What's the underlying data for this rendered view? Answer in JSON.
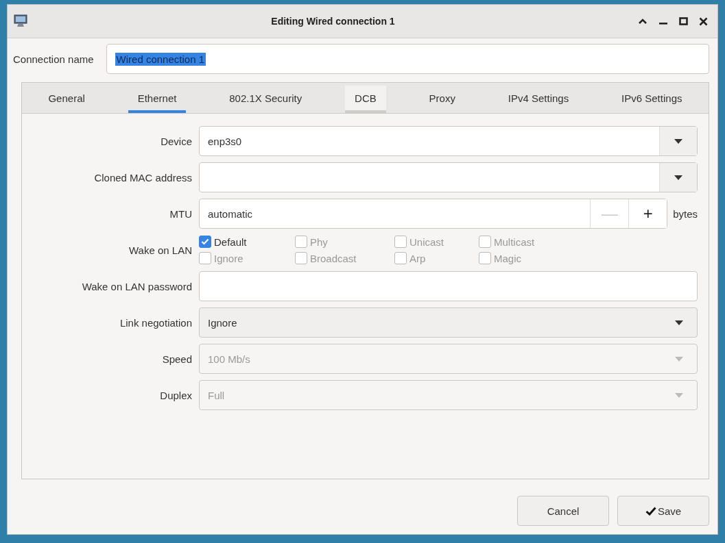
{
  "window": {
    "title": "Editing Wired connection 1"
  },
  "connection_name": {
    "label": "Connection name",
    "value": "Wired connection 1"
  },
  "tabs": [
    {
      "label": "General",
      "selected": false,
      "hovered": false
    },
    {
      "label": "Ethernet",
      "selected": true,
      "hovered": false
    },
    {
      "label": "802.1X Security",
      "selected": false,
      "hovered": false
    },
    {
      "label": "DCB",
      "selected": false,
      "hovered": true
    },
    {
      "label": "Proxy",
      "selected": false,
      "hovered": false
    },
    {
      "label": "IPv4 Settings",
      "selected": false,
      "hovered": false
    },
    {
      "label": "IPv6 Settings",
      "selected": false,
      "hovered": false
    }
  ],
  "fields": [
    {
      "kind": "combo",
      "label": "Device",
      "value": "enp3s0"
    },
    {
      "kind": "combo",
      "label": "Cloned MAC address"
    },
    {
      "kind": "spin",
      "label": "MTU",
      "value": "automatic",
      "unit": "bytes",
      "minus": "—",
      "plus": "+"
    },
    {
      "kind": "checks",
      "label": "Wake on LAN",
      "options": [
        {
          "label": "Default",
          "checked": true,
          "disabled": false
        },
        {
          "label": "Phy",
          "checked": false,
          "disabled": true
        },
        {
          "label": "Unicast",
          "checked": false,
          "disabled": true
        },
        {
          "label": "Multicast",
          "checked": false,
          "disabled": true
        },
        {
          "label": "Ignore",
          "checked": false,
          "disabled": true
        },
        {
          "label": "Broadcast",
          "checked": false,
          "disabled": true
        },
        {
          "label": "Arp",
          "checked": false,
          "disabled": true
        },
        {
          "label": "Magic",
          "checked": false,
          "disabled": true
        }
      ]
    },
    {
      "kind": "entry",
      "label": "Wake on LAN password"
    },
    {
      "kind": "select",
      "label": "Link negotiation",
      "value": "Ignore",
      "disabled": false
    },
    {
      "kind": "select",
      "label": "Speed",
      "value": "100 Mb/s",
      "disabled": true
    },
    {
      "kind": "select",
      "label": "Duplex",
      "value": "Full",
      "disabled": true
    }
  ],
  "buttons": [
    {
      "kind": "cancel",
      "label": "Cancel"
    },
    {
      "kind": "save",
      "label": "Save"
    }
  ]
}
